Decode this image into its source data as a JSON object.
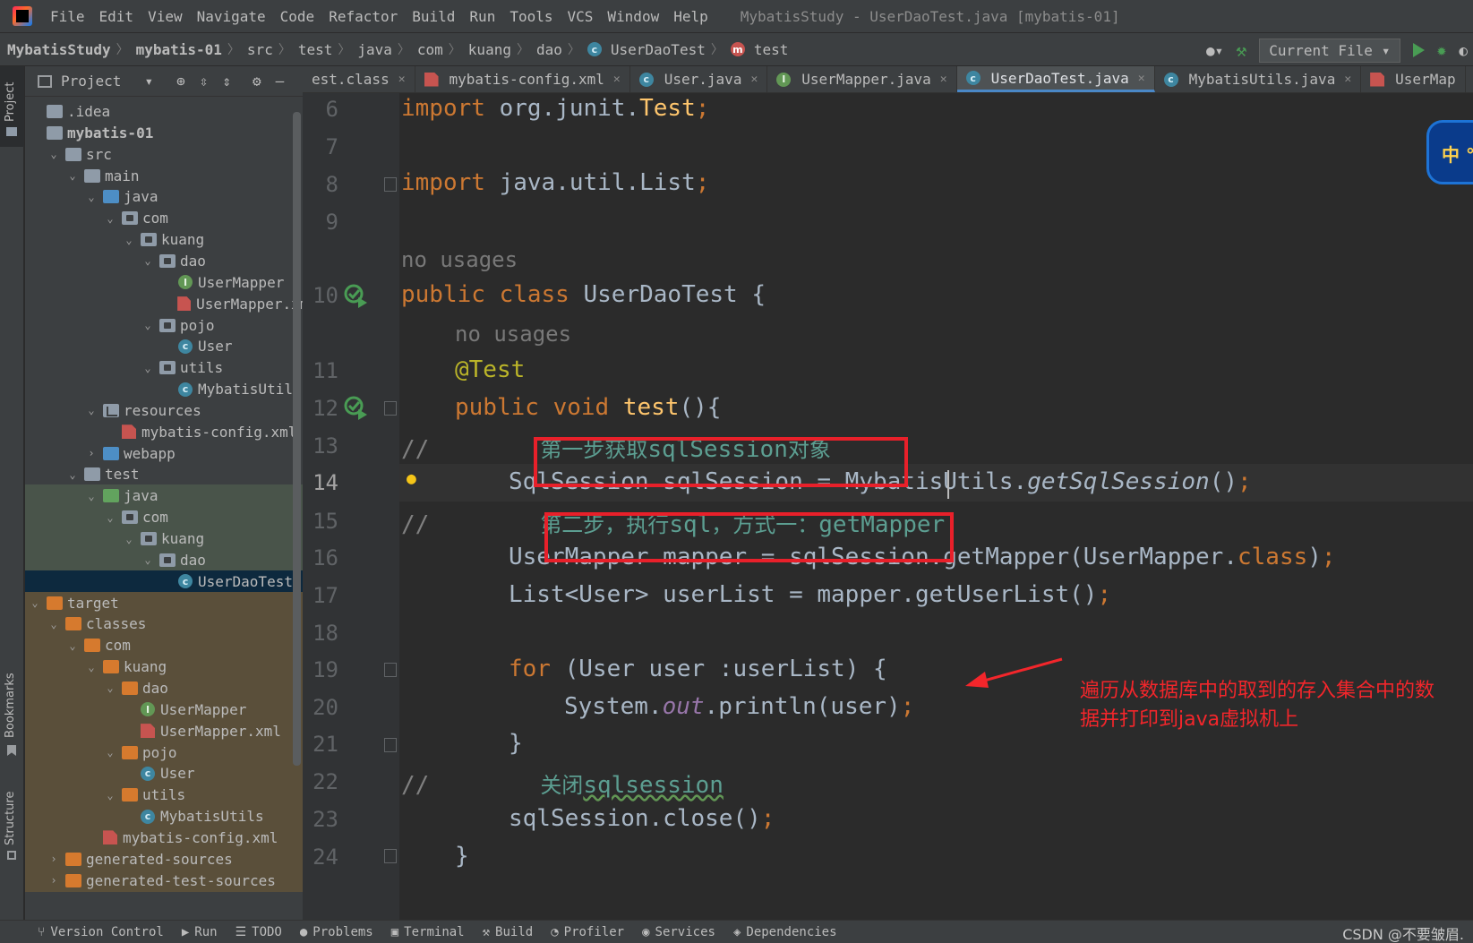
{
  "window": {
    "title": "MybatisStudy - UserDaoTest.java [mybatis-01]"
  },
  "menu": [
    "File",
    "Edit",
    "View",
    "Navigate",
    "Code",
    "Refactor",
    "Build",
    "Run",
    "Tools",
    "VCS",
    "Window",
    "Help"
  ],
  "breadcrumb": [
    "MybatisStudy",
    "mybatis-01",
    "src",
    "test",
    "java",
    "com",
    "kuang",
    "dao",
    "UserDaoTest",
    "test"
  ],
  "toolbar": {
    "run_config": "Current File"
  },
  "project_panel": {
    "title": "Project",
    "tree": [
      {
        "label": ".idea",
        "depth": 0,
        "kind": "folder",
        "chev": ""
      },
      {
        "label": "mybatis-01",
        "depth": 0,
        "kind": "folder",
        "chev": "",
        "bold": true
      },
      {
        "label": "src",
        "depth": 1,
        "kind": "folder",
        "chev": "v"
      },
      {
        "label": "main",
        "depth": 2,
        "kind": "folder",
        "chev": "v"
      },
      {
        "label": "java",
        "depth": 3,
        "kind": "folder-blue",
        "chev": "v"
      },
      {
        "label": "com",
        "depth": 4,
        "kind": "pkg",
        "chev": "v"
      },
      {
        "label": "kuang",
        "depth": 5,
        "kind": "pkg",
        "chev": "v"
      },
      {
        "label": "dao",
        "depth": 6,
        "kind": "pkg",
        "chev": "v"
      },
      {
        "label": "UserMapper",
        "depth": 7,
        "kind": "interface",
        "chev": ""
      },
      {
        "label": "UserMapper.xml",
        "depth": 7,
        "kind": "xml",
        "chev": ""
      },
      {
        "label": "pojo",
        "depth": 6,
        "kind": "pkg",
        "chev": "v"
      },
      {
        "label": "User",
        "depth": 7,
        "kind": "class",
        "chev": ""
      },
      {
        "label": "utils",
        "depth": 6,
        "kind": "pkg",
        "chev": "v"
      },
      {
        "label": "MybatisUtils",
        "depth": 7,
        "kind": "class",
        "chev": ""
      },
      {
        "label": "resources",
        "depth": 3,
        "kind": "res",
        "chev": "v"
      },
      {
        "label": "mybatis-config.xml",
        "depth": 4,
        "kind": "xml",
        "chev": ""
      },
      {
        "label": "webapp",
        "depth": 3,
        "kind": "folder-blue",
        "chev": ">"
      },
      {
        "label": "test",
        "depth": 2,
        "kind": "folder",
        "chev": "v"
      },
      {
        "label": "java",
        "depth": 3,
        "kind": "folder-green",
        "chev": "v",
        "hl": "test"
      },
      {
        "label": "com",
        "depth": 4,
        "kind": "pkg",
        "chev": "v",
        "hl": "test"
      },
      {
        "label": "kuang",
        "depth": 5,
        "kind": "pkg",
        "chev": "v",
        "hl": "test"
      },
      {
        "label": "dao",
        "depth": 6,
        "kind": "pkg",
        "chev": "v",
        "hl": "test"
      },
      {
        "label": "UserDaoTest",
        "depth": 7,
        "kind": "class",
        "chev": "",
        "hl": "sel"
      },
      {
        "label": "target",
        "depth": 0,
        "kind": "folder-orange",
        "chev": "v",
        "hl": "target"
      },
      {
        "label": "classes",
        "depth": 1,
        "kind": "folder-orange",
        "chev": "v",
        "hl": "target"
      },
      {
        "label": "com",
        "depth": 2,
        "kind": "folder-orange",
        "chev": "v",
        "hl": "target"
      },
      {
        "label": "kuang",
        "depth": 3,
        "kind": "folder-orange",
        "chev": "v",
        "hl": "target"
      },
      {
        "label": "dao",
        "depth": 4,
        "kind": "folder-orange",
        "chev": "v",
        "hl": "target"
      },
      {
        "label": "UserMapper",
        "depth": 5,
        "kind": "interface",
        "chev": "",
        "hl": "target"
      },
      {
        "label": "UserMapper.xml",
        "depth": 5,
        "kind": "xml",
        "chev": "",
        "hl": "target"
      },
      {
        "label": "pojo",
        "depth": 4,
        "kind": "folder-orange",
        "chev": "v",
        "hl": "target"
      },
      {
        "label": "User",
        "depth": 5,
        "kind": "class",
        "chev": "",
        "hl": "target"
      },
      {
        "label": "utils",
        "depth": 4,
        "kind": "folder-orange",
        "chev": "v",
        "hl": "target"
      },
      {
        "label": "MybatisUtils",
        "depth": 5,
        "kind": "class",
        "chev": "",
        "hl": "target"
      },
      {
        "label": "mybatis-config.xml",
        "depth": 3,
        "kind": "xml",
        "chev": "",
        "hl": "target"
      },
      {
        "label": "generated-sources",
        "depth": 1,
        "kind": "folder-orange",
        "chev": ">",
        "hl": "target"
      },
      {
        "label": "generated-test-sources",
        "depth": 1,
        "kind": "folder-orange",
        "chev": ">",
        "hl": "target"
      }
    ]
  },
  "side_labels": {
    "project": "Project",
    "bookmarks": "Bookmarks",
    "structure": "Structure"
  },
  "tabs": [
    {
      "label": "est.class",
      "icon": "",
      "active": false
    },
    {
      "label": "mybatis-config.xml",
      "icon": "xml",
      "active": false
    },
    {
      "label": "User.java",
      "icon": "class",
      "active": false
    },
    {
      "label": "UserMapper.java",
      "icon": "interface",
      "active": false
    },
    {
      "label": "UserDaoTest.java",
      "icon": "class",
      "active": true
    },
    {
      "label": "MybatisUtils.java",
      "icon": "class",
      "active": false
    },
    {
      "label": "UserMap",
      "icon": "xml",
      "active": false
    }
  ],
  "editor": {
    "lines": [
      "6",
      "7",
      "8",
      "9",
      "10",
      "11",
      "12",
      "13",
      "14",
      "15",
      "16",
      "17",
      "18",
      "19",
      "20",
      "21",
      "22",
      "23",
      "24"
    ],
    "current_line": "14",
    "code": {
      "l6": [
        "import",
        " org.junit.",
        "Test",
        ";"
      ],
      "l8": [
        "import",
        " java.util.List",
        ";"
      ],
      "hint_class": "no usages",
      "l10": [
        "public class",
        " UserDaoTest {"
      ],
      "hint_method": "no usages",
      "l11": "@Test",
      "l12": [
        "public void",
        " ",
        "test",
        "(){"
      ],
      "l13": [
        "//",
        "第一步获取",
        "sqlSession",
        "对象"
      ],
      "l14": [
        "SqlSession sqlSession = MybatisUtils.",
        "getSqlSession",
        "()",
        ";"
      ],
      "l15": [
        "//",
        "第二步，执行",
        "sql",
        "，方式一：",
        "getMapper"
      ],
      "l16": [
        "UserMapper mapper = sqlSession.getMapper(UserMapper.",
        "class",
        ")",
        ";"
      ],
      "l17": [
        "List<User> userList = mapper.getUserList()",
        ";"
      ],
      "l19": [
        "for",
        " (User user :userList) {"
      ],
      "l20": [
        "System.",
        "out",
        ".println(user)",
        ";"
      ],
      "l21": "}",
      "l22": [
        "//",
        "关闭",
        "sqlsession"
      ],
      "l23": [
        "sqlSession.close()",
        ";"
      ],
      "l24": "}"
    },
    "annotation": "遍历从数据库中的取到的存入集合中的数\n据并打印到java虚拟机上",
    "ime_badge": "中 °"
  },
  "statusbar": {
    "items": [
      "Version Control",
      "Run",
      "TODO",
      "Problems",
      "Terminal",
      "Build",
      "Profiler",
      "Services",
      "Dependencies"
    ],
    "watermark": "CSDN @不要皱眉."
  },
  "colors": {
    "keyword": "#cc7832",
    "annotation_red": "#f3262b",
    "selection": "#0d293e",
    "accent_tab": "#4a88c7"
  }
}
